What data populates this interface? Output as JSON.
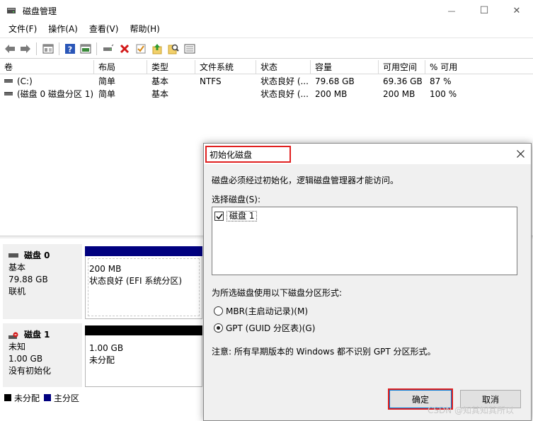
{
  "window": {
    "title": "磁盘管理",
    "controls": {
      "minimize": "—",
      "maximize": "☐",
      "close": "✕"
    }
  },
  "menu": [
    "文件(F)",
    "操作(A)",
    "查看(V)",
    "帮助(H)"
  ],
  "toolbar": {
    "icons": [
      "back-arrow-icon",
      "forward-arrow-icon",
      "properties-icon",
      "help-icon",
      "console-icon",
      "connect-drive-icon",
      "delete-icon",
      "check-icon",
      "folder-up-icon",
      "search-icon",
      "list-icon"
    ]
  },
  "volume_table": {
    "columns": [
      "卷",
      "布局",
      "类型",
      "文件系统",
      "状态",
      "容量",
      "可用空间",
      "% 可用"
    ],
    "rows": [
      [
        "(C:)",
        "简单",
        "基本",
        "NTFS",
        "状态良好 (...",
        "79.68 GB",
        "69.36 GB",
        "87 %"
      ],
      [
        "(磁盘 0 磁盘分区 1)",
        "简单",
        "基本",
        "",
        "状态良好 (...",
        "200 MB",
        "200 MB",
        "100 %"
      ]
    ]
  },
  "disks": [
    {
      "name": "磁盘 0",
      "type": "基本",
      "size": "79.88 GB",
      "status": "联机",
      "partition": {
        "size": "200 MB",
        "status": "状态良好 (EFI 系统分区)"
      }
    },
    {
      "name": "磁盘 1",
      "type": "未知",
      "size": "1.00 GB",
      "status": "没有初始化",
      "partition": {
        "size": "1.00 GB",
        "status": "未分配"
      }
    }
  ],
  "legend": [
    {
      "label": "未分配",
      "color": "#000000"
    },
    {
      "label": "主分区",
      "color": "#00007f"
    }
  ],
  "dialog": {
    "title": "初始化磁盘",
    "message": "磁盘必须经过初始化，逻辑磁盘管理器才能访问。",
    "select_label": "选择磁盘(S):",
    "disk_item": "磁盘 1",
    "partition_style_label": "为所选磁盘使用以下磁盘分区形式:",
    "options": [
      "MBR(主启动记录)(M)",
      "GPT (GUID 分区表)(G)"
    ],
    "selected_option": 1,
    "note": "注意: 所有早期版本的 Windows 都不识别 GPT 分区形式。",
    "ok": "确定",
    "cancel": "取消"
  },
  "watermark": "CSDN @知其知其所以"
}
